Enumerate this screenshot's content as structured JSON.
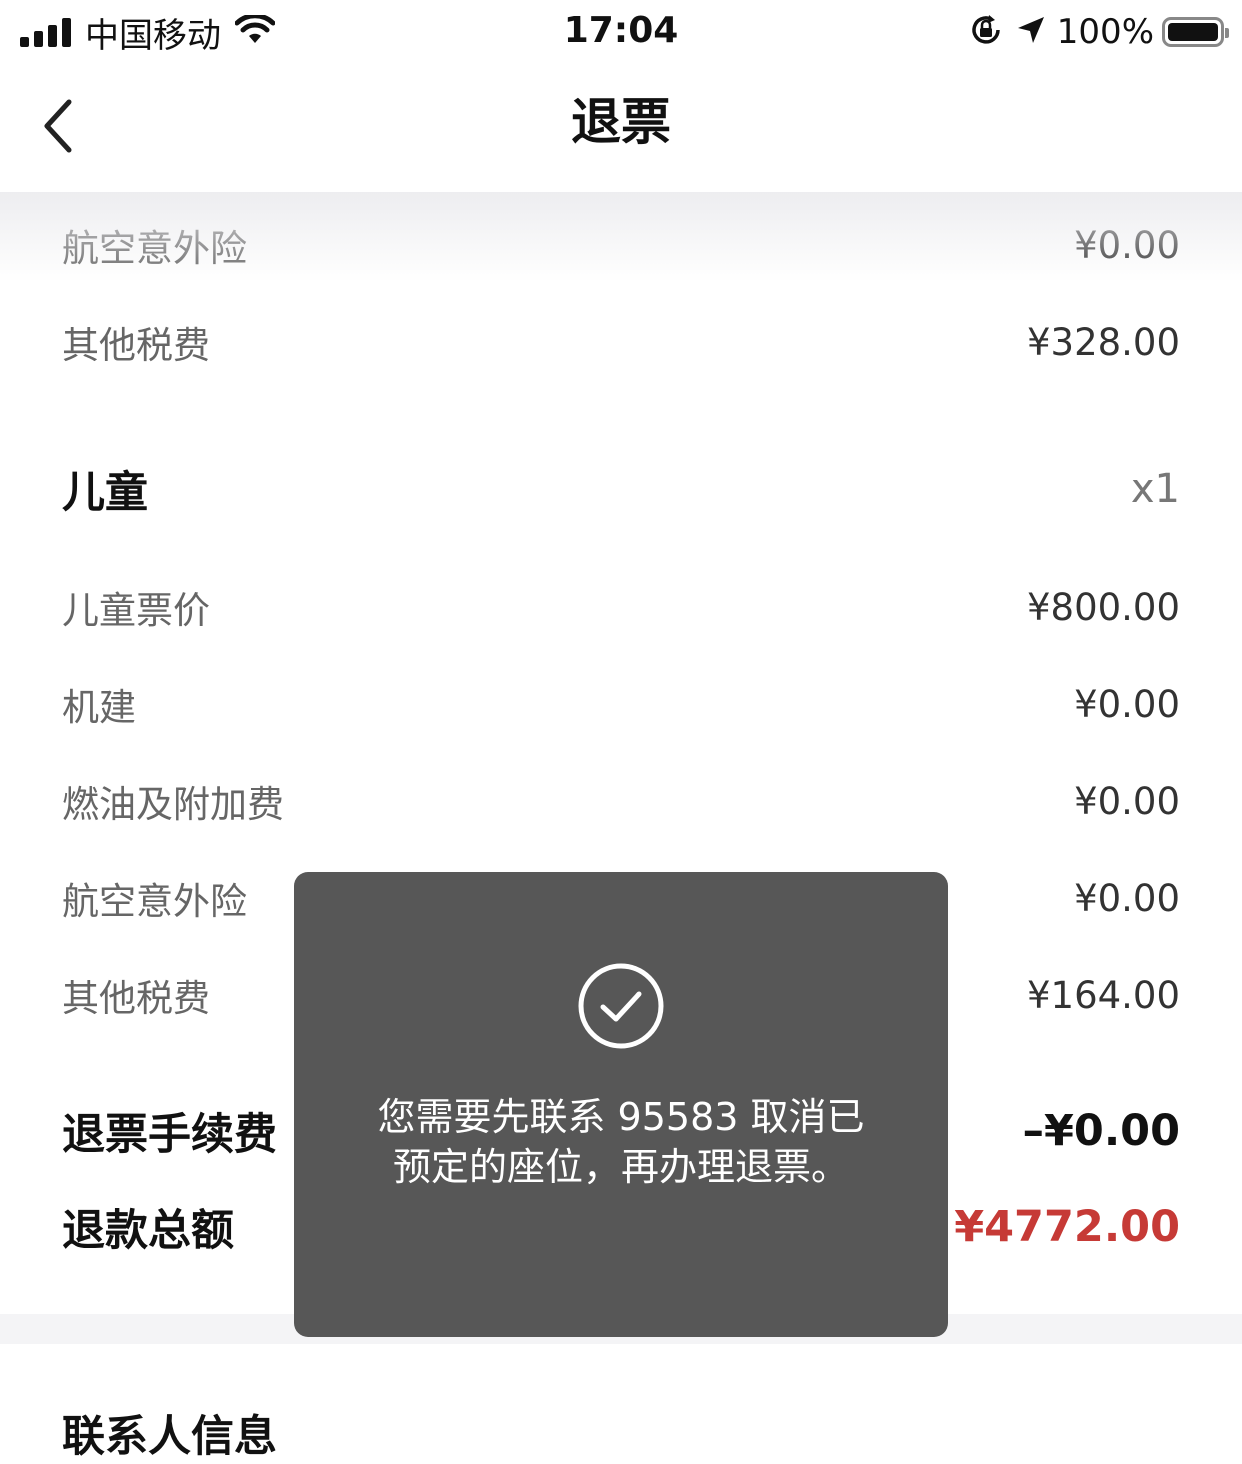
{
  "status_bar": {
    "carrier": "中国移动",
    "time": "17:04",
    "battery": "100%"
  },
  "nav": {
    "title": "退票"
  },
  "adult_tail": {
    "insurance_label": "航空意外险",
    "insurance_value": "¥0.00",
    "tax_label": "其他税费",
    "tax_value": "¥328.00"
  },
  "child": {
    "title": "儿童",
    "count": "x1",
    "items": [
      {
        "label": "儿童票价",
        "value": "¥800.00"
      },
      {
        "label": "机建",
        "value": "¥0.00"
      },
      {
        "label": "燃油及附加费",
        "value": "¥0.00"
      },
      {
        "label": "航空意外险",
        "value": "¥0.00"
      },
      {
        "label": "其他税费",
        "value": "¥164.00"
      }
    ]
  },
  "summary": {
    "fee_label": "退票手续费",
    "fee_value": "–¥0.00",
    "total_label": "退款总额",
    "total_value": "¥4772.00"
  },
  "contact": {
    "title": "联系人信息"
  },
  "toast": {
    "icon": "check-circle-icon",
    "message": "您需要先联系 95583 取消已预定的座位，再办理退票。"
  },
  "colors": {
    "accent_red": "#c63a36",
    "toast_bg": "#4a4a4a"
  }
}
